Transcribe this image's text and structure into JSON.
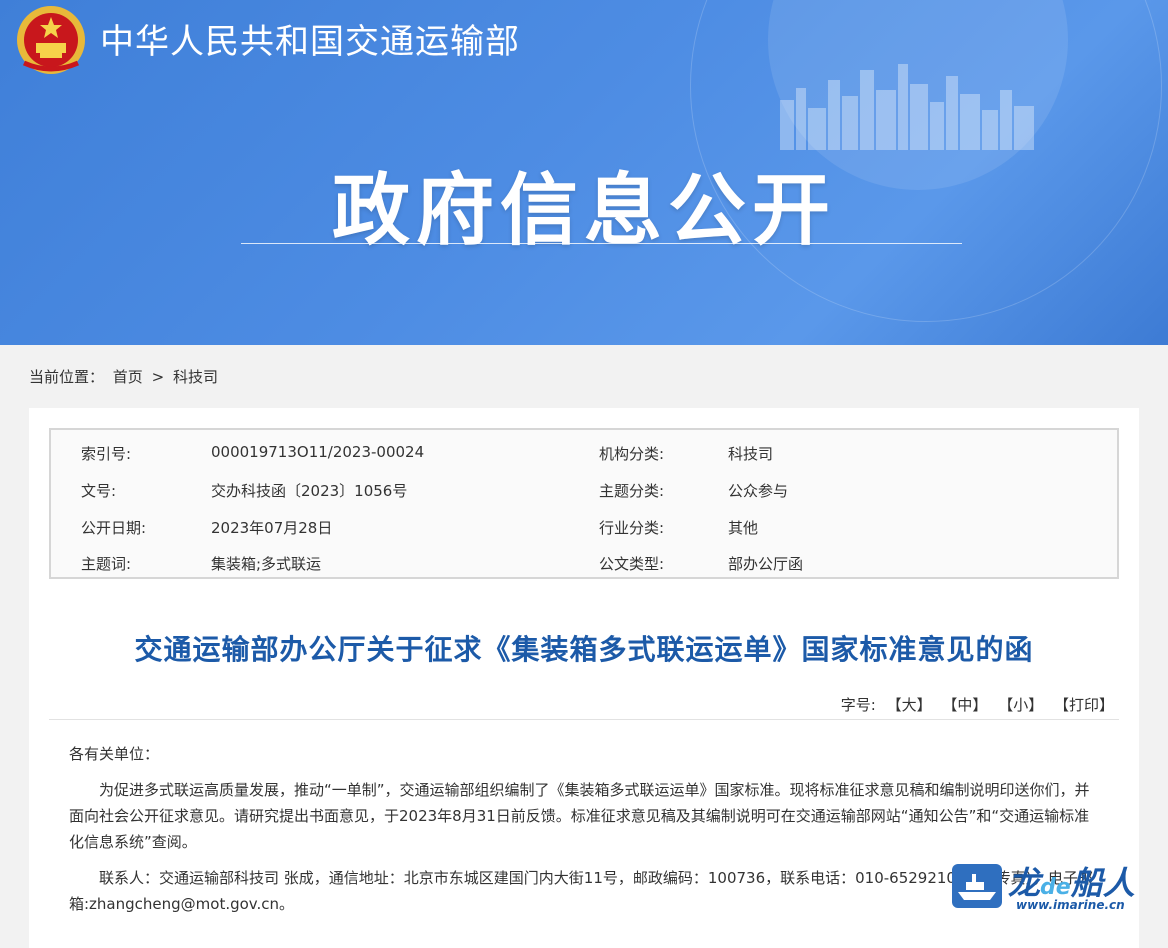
{
  "header": {
    "site_name": "中华人民共和国交通运输部",
    "banner_title": "政府信息公开"
  },
  "breadcrumb": {
    "label": "当前位置：",
    "home": "首页",
    "separator": ">",
    "current": "科技司"
  },
  "meta": {
    "rows": [
      {
        "k1": "索引号:",
        "v1": "000019713O11/2023-00024",
        "k2": "机构分类:",
        "v2": "科技司"
      },
      {
        "k1": "文号:",
        "v1": "交办科技函〔2023〕1056号",
        "k2": "主题分类:",
        "v2": "公众参与"
      },
      {
        "k1": "公开日期:",
        "v1": "2023年07月28日",
        "k2": "行业分类:",
        "v2": "其他"
      },
      {
        "k1": "主题词:",
        "v1": "集装箱;多式联运",
        "k2": "公文类型:",
        "v2": "部办公厅函"
      }
    ]
  },
  "document": {
    "title": "交通运输部办公厅关于征求《集装箱多式联运运单》国家标准意见的函",
    "font_tools": {
      "label": "字号:",
      "large": "【大】",
      "medium": "【中】",
      "small": "【小】",
      "print": "【打印】"
    },
    "salutation": "各有关单位：",
    "paragraph1": "为促进多式联运高质量发展，推动“一单制”，交通运输部组织编制了《集装箱多式联运运单》国家标准。现将标准征求意见稿和编制说明印送你们，并面向社会公开征求意见。请研究提出书面意见，于2023年8月31日前反馈。标准征求意见稿及其编制说明可在交通运输部网站“通知公告”和“交通运输标准化信息系统”查阅。",
    "paragraph2": "联系人：交通运输部科技司 张成，通信地址：北京市东城区建国门内大街11号，邮政编码：100736，联系电话：010-65292100（兼传真），电子邮箱:zhangcheng@mot.gov.cn。"
  },
  "watermark": {
    "brand_a": "龙",
    "brand_de": "de",
    "brand_b": "船人",
    "url": "www.imarine.cn"
  }
}
